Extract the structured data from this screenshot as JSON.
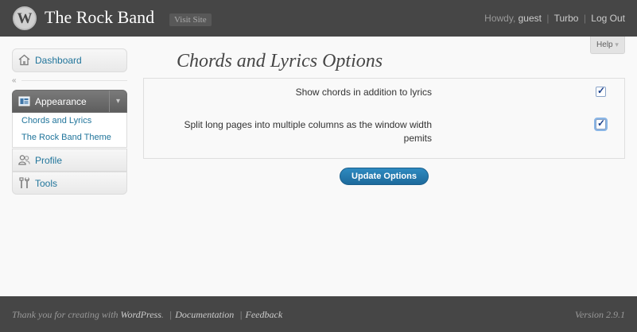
{
  "header": {
    "site_title": "The Rock Band",
    "visit_site": "Visit Site",
    "howdy": "Howdy,",
    "username": "guest",
    "turbo": "Turbo",
    "logout": "Log Out"
  },
  "help": {
    "label": "Help",
    "arrow": "▾"
  },
  "sidebar": {
    "dashboard": "Dashboard",
    "collapse": "«",
    "appearance": "Appearance",
    "appearance_toggle": "▾",
    "submenu": [
      "Chords and Lyrics",
      "The Rock Band Theme"
    ],
    "profile": "Profile",
    "tools": "Tools"
  },
  "main": {
    "title": "Chords and Lyrics Options",
    "options": [
      {
        "label": "Show chords in addition to lyrics",
        "checked": true
      },
      {
        "label": "Split long pages into multiple columns as the window width pemits",
        "checked": true
      }
    ],
    "update_button": "Update Options"
  },
  "footer": {
    "thanks": "Thank you for creating with",
    "wordpress": "WordPress",
    "period": ".",
    "documentation": "Documentation",
    "feedback": "Feedback",
    "version": "Version 2.9.1"
  },
  "colors": {
    "header_bg": "#464646",
    "link": "#21759b",
    "button": "#21759b"
  }
}
